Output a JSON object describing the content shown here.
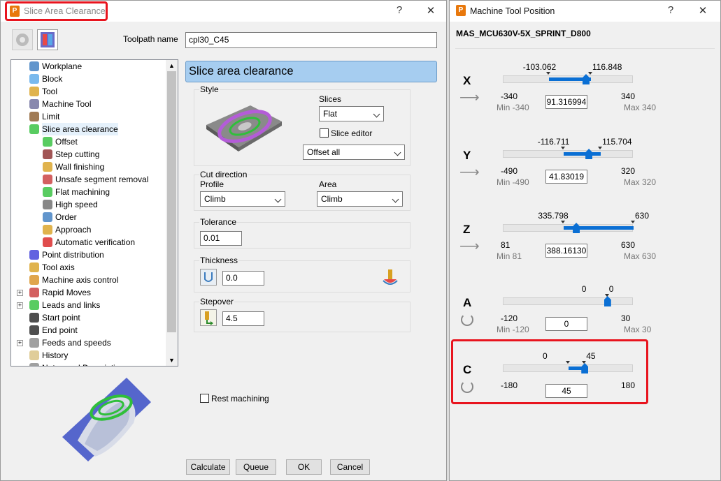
{
  "left": {
    "title": "Slice Area Clearance",
    "help": "?",
    "close": "✕",
    "toolpath_name_label": "Toolpath name",
    "toolpath_name": "cpl30_C45",
    "tree": [
      {
        "label": "Workplane",
        "icon": "workplane-icon",
        "level": 0
      },
      {
        "label": "Block",
        "icon": "block-icon",
        "level": 0
      },
      {
        "label": "Tool",
        "icon": "tool-icon",
        "level": 0
      },
      {
        "label": "Machine Tool",
        "icon": "machine-tool-icon",
        "level": 0
      },
      {
        "label": "Limit",
        "icon": "limit-icon",
        "level": 0
      },
      {
        "label": "Slice area clearance",
        "icon": "slice-area-clearance-icon",
        "level": 0,
        "selected": true
      },
      {
        "label": "Offset",
        "icon": "offset-icon",
        "level": 1
      },
      {
        "label": "Step cutting",
        "icon": "step-cutting-icon",
        "level": 1
      },
      {
        "label": "Wall finishing",
        "icon": "wall-finishing-icon",
        "level": 1
      },
      {
        "label": "Unsafe segment removal",
        "icon": "unsafe-segment-icon",
        "level": 1
      },
      {
        "label": "Flat machining",
        "icon": "flat-machining-icon",
        "level": 1
      },
      {
        "label": "High speed",
        "icon": "high-speed-icon",
        "level": 1
      },
      {
        "label": "Order",
        "icon": "order-icon",
        "level": 1
      },
      {
        "label": "Approach",
        "icon": "approach-icon",
        "level": 1
      },
      {
        "label": "Automatic verification",
        "icon": "verification-icon",
        "level": 1
      },
      {
        "label": "Point distribution",
        "icon": "point-distribution-icon",
        "level": 0
      },
      {
        "label": "Tool axis",
        "icon": "tool-axis-icon",
        "level": 0
      },
      {
        "label": "Machine axis control",
        "icon": "machine-axis-icon",
        "level": 0
      },
      {
        "label": "Rapid Moves",
        "icon": "rapid-moves-icon",
        "level": 0,
        "expandable": true
      },
      {
        "label": "Leads and links",
        "icon": "leads-links-icon",
        "level": 0,
        "expandable": true
      },
      {
        "label": "Start point",
        "icon": "start-point-icon",
        "level": 0
      },
      {
        "label": "End point",
        "icon": "end-point-icon",
        "level": 0
      },
      {
        "label": "Feeds and speeds",
        "icon": "feeds-speeds-icon",
        "level": 0,
        "expandable": true
      },
      {
        "label": "History",
        "icon": "history-icon",
        "level": 0
      },
      {
        "label": "Notes and Description",
        "icon": "notes-icon",
        "level": 0
      }
    ],
    "header": "Slice area clearance",
    "style_label": "Style",
    "slices_label": "Slices",
    "slices_value": "Flat",
    "slice_editor_label": "Slice editor",
    "offset_value": "Offset all",
    "cut_direction_label": "Cut direction",
    "profile_label": "Profile",
    "profile_value": "Climb",
    "area_label": "Area",
    "area_value": "Climb",
    "tolerance_label": "Tolerance",
    "tolerance_value": "0.01",
    "thickness_label": "Thickness",
    "thickness_value": "0.0",
    "stepover_label": "Stepover",
    "stepover_value": "4.5",
    "rest_machining_label": "Rest machining",
    "buttons": {
      "calculate": "Calculate",
      "queue": "Queue",
      "ok": "OK",
      "cancel": "Cancel"
    }
  },
  "right": {
    "title": "Machine Tool Position",
    "help": "?",
    "close": "✕",
    "machine_name": "MAS_MCU630V-5X_SPRINT_D800",
    "axes": [
      {
        "name": "X",
        "low_marker": "-103.062",
        "high_marker": "116.848",
        "min": "-340",
        "max": "340",
        "min_label": "Min -340",
        "max_label": "Max 340",
        "value": "91.316994",
        "linear": true,
        "min_num": -340,
        "max_num": 340,
        "lo": -103.062,
        "hi": 116.848,
        "pos": 91.316994
      },
      {
        "name": "Y",
        "low_marker": "-116.711",
        "high_marker": "115.704",
        "min": "-490",
        "max": "320",
        "min_label": "Min -490",
        "max_label": "Max 320",
        "value": "41.83019",
        "linear": true,
        "min_num": -490,
        "max_num": 320,
        "lo": -116.711,
        "hi": 115.704,
        "pos": 41.83019
      },
      {
        "name": "Z",
        "low_marker": "335.798",
        "high_marker": "630",
        "min": "81",
        "max": "630",
        "min_label": "Min 81",
        "max_label": "Max 630",
        "value": "388.16130",
        "linear": true,
        "min_num": 81,
        "max_num": 630,
        "lo": 335.798,
        "hi": 630,
        "pos": 388.1613
      },
      {
        "name": "A",
        "low_marker": "0",
        "high_marker": "0",
        "min": "-120",
        "max": "30",
        "min_label": "Min -120",
        "max_label": "Max 30",
        "value": "0",
        "linear": false,
        "min_num": -120,
        "max_num": 30,
        "lo": 0,
        "hi": 0,
        "pos": 0
      },
      {
        "name": "C",
        "low_marker": "0",
        "high_marker": "45",
        "min": "-180",
        "max": "180",
        "min_label": "",
        "max_label": "",
        "value": "45",
        "linear": false,
        "min_num": -180,
        "max_num": 180,
        "lo": 0,
        "hi": 45,
        "pos": 45
      }
    ]
  },
  "colors": {
    "accent": "#0a6fd4",
    "highlight": "#e8141e",
    "header_bg": "#a6cdf0"
  }
}
